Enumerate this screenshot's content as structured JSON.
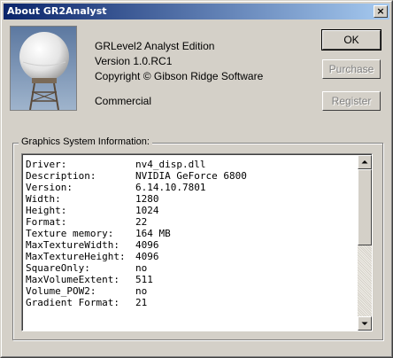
{
  "window": {
    "title": "About GR2Analyst",
    "close_glyph": "×"
  },
  "app": {
    "edition": "GRLevel2 Analyst Edition",
    "version": "Version 1.0.RC1",
    "copyright": "Copyright © Gibson Ridge Software",
    "license": "Commercial"
  },
  "buttons": {
    "ok": "OK",
    "purchase": "Purchase",
    "register": "Register"
  },
  "graphics": {
    "group_label": "Graphics System Information:",
    "rows": [
      {
        "key": "Driver:",
        "value": "nv4_disp.dll"
      },
      {
        "key": "Description:",
        "value": "NVIDIA GeForce 6800"
      },
      {
        "key": "Version:",
        "value": "6.14.10.7801"
      },
      {
        "key": "Width:",
        "value": "1280"
      },
      {
        "key": "Height:",
        "value": "1024"
      },
      {
        "key": "Format:",
        "value": "22"
      },
      {
        "key": "Texture memory:",
        "value": "164 MB"
      },
      {
        "key": "MaxTextureWidth:",
        "value": "4096"
      },
      {
        "key": "MaxTextureHeight:",
        "value": "4096"
      },
      {
        "key": "SquareOnly:",
        "value": "no"
      },
      {
        "key": "MaxVolumeExtent:",
        "value": "511"
      },
      {
        "key": "Volume_POW2:",
        "value": "no"
      },
      {
        "key": "Gradient Format:",
        "value": "21"
      }
    ]
  },
  "colors": {
    "title_start": "#0a246a",
    "title_end": "#a6caf0",
    "face": "#d4d0c8"
  }
}
